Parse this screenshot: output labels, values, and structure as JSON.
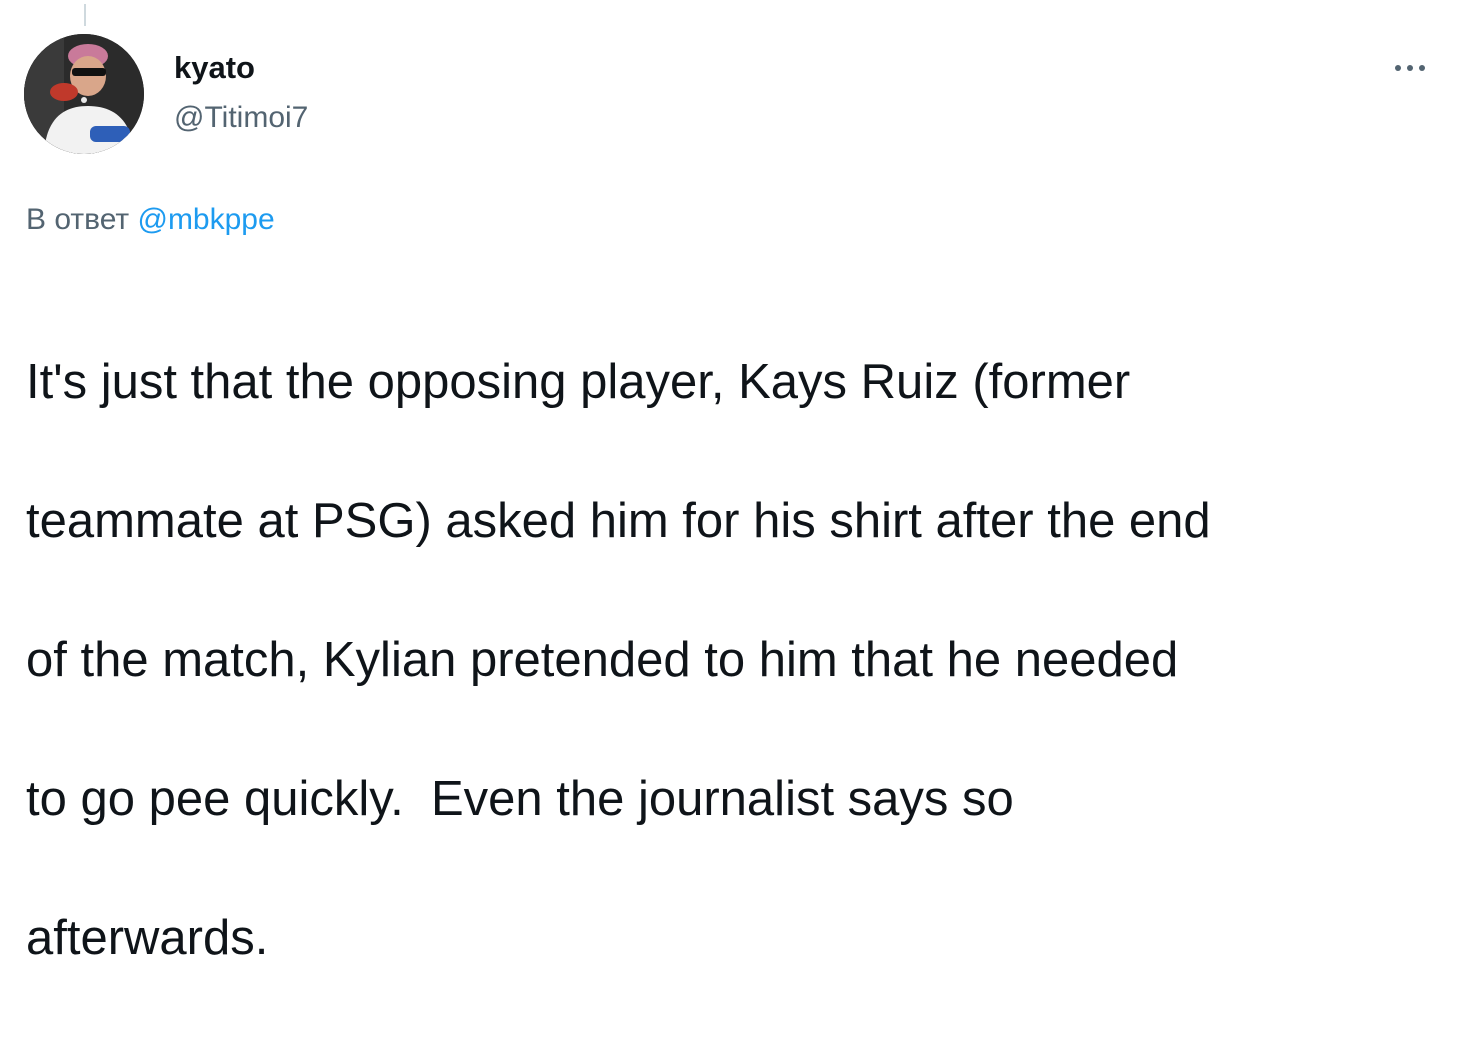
{
  "author": {
    "display_name": "kyato",
    "handle": "@Titimoi7"
  },
  "icons": {
    "avatar": "avatar-photo",
    "more": "more-horizontal-icon"
  },
  "reply": {
    "prefix": "В ответ",
    "mention": "@mbkppe"
  },
  "tweet": {
    "text_lines": [
      "It's just that the opposing player, Kays Ruiz (former",
      "teammate at PSG) asked him for his shirt after the end",
      "of the match, Kylian pretended to him that he needed",
      "to go pee quickly.  Even the journalist says so",
      "afterwards."
    ]
  },
  "colors": {
    "text_primary": "#0f1419",
    "text_secondary": "#536471",
    "link": "#1d9bf0",
    "thread_line": "#cfd9de"
  }
}
